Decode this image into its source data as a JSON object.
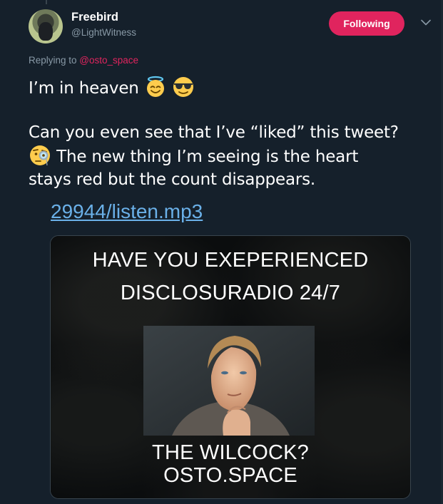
{
  "tweet": {
    "display_name": "Freebird",
    "handle": "@LightWitness",
    "follow_label": "Following",
    "replying_prefix": "Replying to ",
    "replying_mention": "@osto_space",
    "line1": "I’m in heaven",
    "line2": "Can you even see that I’ve “liked” this tweet?",
    "line3": "The new thing I’m seeing is the heart",
    "line4": "stays red but the count disappears.",
    "link_text": "29944/listen.mp3"
  },
  "card": {
    "title_line1": "HAVE YOU EXEPERIENCED",
    "title_line2": "DISCLOSURADIO 24/7",
    "caption_line1": "THE WILCOCK?",
    "caption_line2": "OSTO.SPACE"
  },
  "icons": {
    "emoji_1": "smiling-face-with-halo",
    "emoji_2": "smiling-face-with-sunglasses",
    "emoji_3": "face-with-monocle",
    "chevron": "chevron-down-icon"
  },
  "colors": {
    "background": "#15202b",
    "follow_button": "#e0245e",
    "mention": "#e0245e",
    "link": "#6ab0e8",
    "secondary_text": "#8899a6"
  }
}
